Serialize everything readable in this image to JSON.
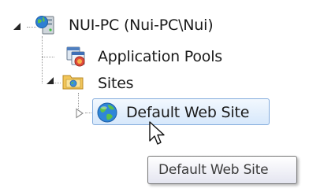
{
  "tree": {
    "server": {
      "label": "NUI-PC (Nui-PC\\Nui)",
      "icon": "server-icon",
      "expanded": true
    },
    "app_pools": {
      "label": "Application Pools",
      "icon": "application-pools-icon"
    },
    "sites": {
      "label": "Sites",
      "icon": "sites-folder-icon",
      "expanded": true
    },
    "default_site": {
      "label": "Default Web Site",
      "icon": "globe-icon",
      "expanded": false,
      "selected": true
    }
  },
  "tooltip": {
    "text": "Default Web Site"
  },
  "colors": {
    "selection_border": "#84acdd",
    "selection_fill": "#d7e8fb",
    "tooltip_border": "#767676"
  }
}
